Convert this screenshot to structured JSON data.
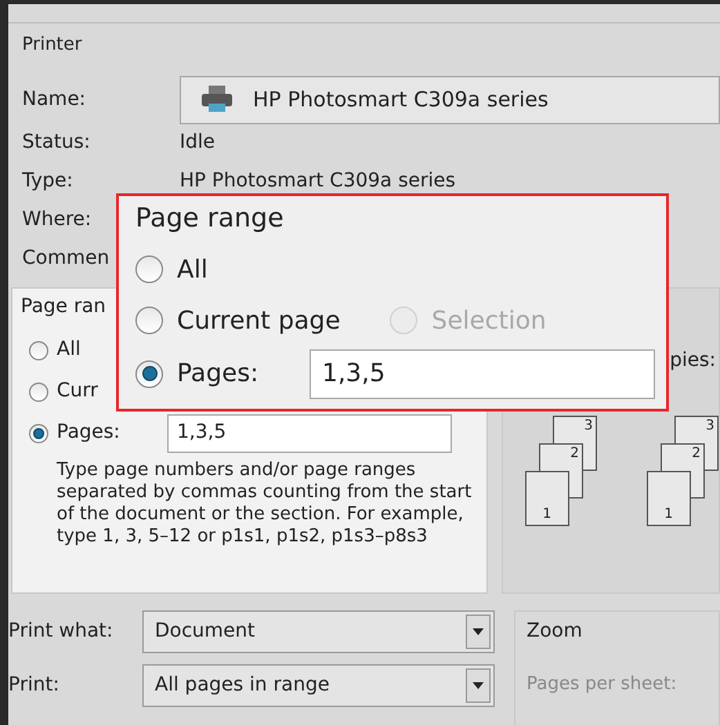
{
  "printer": {
    "title": "Printer",
    "name_label": "Name:",
    "name_value": "HP Photosmart C309a series",
    "fields": [
      {
        "label": "Status:",
        "value": "Idle"
      },
      {
        "label": "Type:",
        "value": "HP Photosmart C309a series"
      },
      {
        "label": "Where:"
      },
      {
        "label": "Commen"
      }
    ]
  },
  "page_range": {
    "title": "Page ran",
    "options": [
      {
        "label": "All",
        "selected": false
      },
      {
        "label": "Curr",
        "selected": false
      },
      {
        "label": "Pages:",
        "selected": true
      }
    ],
    "pages_value": "1,3,5",
    "help": "Type page numbers and/or page ranges separated by commas counting from the start of the document or the section. For example, type 1, 3, 5–12 or p1s1, p1s2, p1s3–p8s3"
  },
  "copies": {
    "label": "pies:",
    "stacks": [
      {
        "pages": [
          "3",
          "2",
          "1"
        ]
      },
      {
        "pages": [
          "3",
          "2",
          "1"
        ]
      }
    ]
  },
  "print_what": {
    "label": "Print what:",
    "value": "Document"
  },
  "print": {
    "label": "Print:",
    "value": "All pages in range"
  },
  "zoom": {
    "title": "Zoom",
    "pages_per_sheet": "Pages per sheet:"
  },
  "callout": {
    "title": "Page range",
    "options": [
      {
        "label": "All",
        "selected": false,
        "disabled": false
      },
      {
        "label": "Current page",
        "selected": false,
        "disabled": false
      },
      {
        "label": "Selection",
        "selected": false,
        "disabled": true
      },
      {
        "label": "Pages:",
        "selected": true,
        "disabled": false
      }
    ],
    "pages_value": "1,3,5"
  }
}
